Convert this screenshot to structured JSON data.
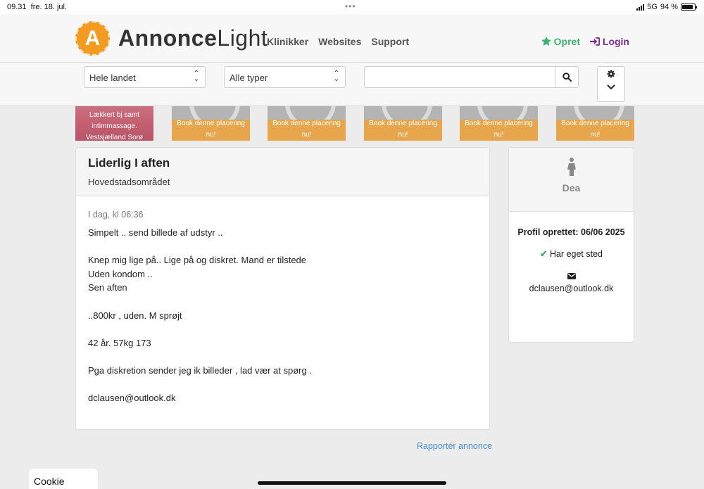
{
  "status_bar": {
    "time": "09.31",
    "date": "fre. 18. jul.",
    "dots": "•••",
    "network": "5G",
    "battery": "94 %"
  },
  "header": {
    "logo_letter": "A",
    "logo_bold": "Annonce",
    "logo_light": "Light",
    "nav": [
      "Klinikker",
      "Websites",
      "Support"
    ],
    "opret": "Opret",
    "login": "Login",
    "colors": {
      "logo": "#f39a21",
      "opret": "#3cb371",
      "login": "#7b2e8f"
    }
  },
  "search": {
    "region_value": "Hele landet",
    "type_value": "Alle typer",
    "query_value": ""
  },
  "ads": [
    {
      "kind": "image",
      "text": "Lækkert bj samt intimmassage. Vestsjælland Sorø"
    },
    {
      "kind": "book",
      "text": "Book denne placering nu!"
    },
    {
      "kind": "book",
      "text": "Book denne placering nu!"
    },
    {
      "kind": "book",
      "text": "Book denne placering nu!"
    },
    {
      "kind": "book",
      "text": "Book denne placering nu!"
    },
    {
      "kind": "book",
      "text": "Book denne placering nu!"
    }
  ],
  "listing": {
    "title": "Liderlig I aften",
    "region": "Hovedstadsområdet",
    "date": "I dag, kl 06:36",
    "body": "Simpelt .. send billede af udstyr ..\n\nKnep mig lige på.. Lige på og diskret. Mand er tilstede\nUden kondom ..\nSen aften\n\n..800kr , uden. M sprøjt\n\n42 år. 57kg 173\n\nPga diskretion sender jeg ik billeder , lad vær at spørg .\n\ndclausen@outlook.dk"
  },
  "profile": {
    "name": "Dea",
    "created": "Profil oprettet: 06/06 2025",
    "place": "Har eget sted",
    "email": "dclausen@outlook.dk"
  },
  "report_link": "Rapportér annonce",
  "cookie_policy": "Cookie Policy"
}
